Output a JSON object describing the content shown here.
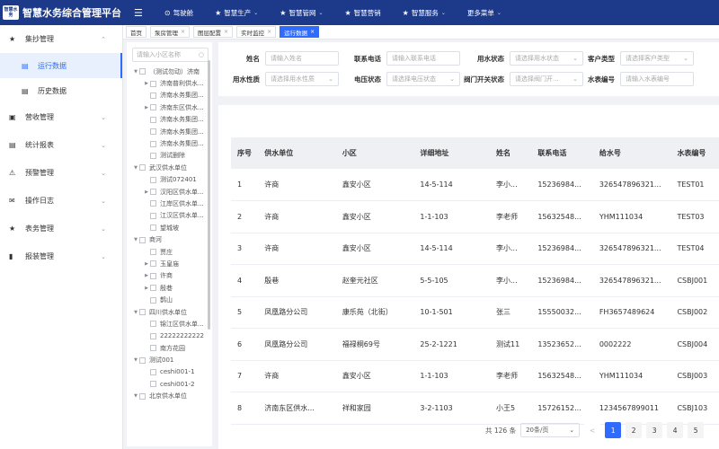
{
  "app": {
    "logo_text": "智慧水务",
    "title": "智慧水务综合管理平台"
  },
  "topnav": [
    {
      "icon": "⊙",
      "label": "驾驶舱",
      "dropdown": false
    },
    {
      "icon": "★",
      "label": "智慧生产",
      "dropdown": true
    },
    {
      "icon": "★",
      "label": "智慧管网",
      "dropdown": true
    },
    {
      "icon": "★",
      "label": "智慧营销",
      "dropdown": false
    },
    {
      "icon": "★",
      "label": "智慧服务",
      "dropdown": true
    },
    {
      "icon": "",
      "label": "更多菜单",
      "dropdown": true
    }
  ],
  "sidebar": {
    "items": [
      {
        "icon": "★",
        "label": "集抄管理",
        "expanded": true
      },
      {
        "icon": "▣",
        "label": "营收管理"
      },
      {
        "icon": "▤",
        "label": "统计报表"
      },
      {
        "icon": "⚠",
        "label": "预警管理"
      },
      {
        "icon": "✉",
        "label": "操作日志"
      },
      {
        "icon": "★",
        "label": "表务管理"
      },
      {
        "icon": "▮",
        "label": "报装管理"
      }
    ],
    "subitems": [
      {
        "label": "运行数据",
        "active": true
      },
      {
        "label": "历史数据",
        "active": false
      }
    ]
  },
  "tabs": [
    {
      "label": "首页",
      "closable": false,
      "active": false
    },
    {
      "label": "泵房管理",
      "closable": true,
      "active": false
    },
    {
      "label": "图层配置",
      "closable": true,
      "active": false
    },
    {
      "label": "实时监控",
      "closable": true,
      "active": false
    },
    {
      "label": "运行数据",
      "closable": true,
      "active": true
    }
  ],
  "tree": {
    "search_placeholder": "请输入小区名称",
    "nodes": [
      {
        "level": 0,
        "toggle": "▼",
        "label": "（测试勿动）济南"
      },
      {
        "level": 1,
        "toggle": "▶",
        "label": "济南普利供水..."
      },
      {
        "level": 1,
        "toggle": "",
        "label": "济南水务集团..."
      },
      {
        "level": 1,
        "toggle": "▶",
        "label": "济南东区供水..."
      },
      {
        "level": 1,
        "toggle": "",
        "label": "济南水务集团..."
      },
      {
        "level": 1,
        "toggle": "",
        "label": "济南水务集团..."
      },
      {
        "level": 1,
        "toggle": "",
        "label": "济南水务集团..."
      },
      {
        "level": 1,
        "toggle": "",
        "label": "测试删除"
      },
      {
        "level": 0,
        "toggle": "▼",
        "label": "武汉供水单位"
      },
      {
        "level": 1,
        "toggle": "",
        "label": "测试072401"
      },
      {
        "level": 1,
        "toggle": "▶",
        "label": "汉阳区供水单..."
      },
      {
        "level": 1,
        "toggle": "",
        "label": "江岸区供水单..."
      },
      {
        "level": 1,
        "toggle": "",
        "label": "江汉区供水单..."
      },
      {
        "level": 1,
        "toggle": "",
        "label": "望城坡"
      },
      {
        "level": 0,
        "toggle": "▼",
        "label": "商河"
      },
      {
        "level": 1,
        "toggle": "",
        "label": "贾庄"
      },
      {
        "level": 1,
        "toggle": "▶",
        "label": "玉皇庙"
      },
      {
        "level": 1,
        "toggle": "▶",
        "label": "许商"
      },
      {
        "level": 1,
        "toggle": "▶",
        "label": "殷巷"
      },
      {
        "level": 1,
        "toggle": "",
        "label": "鹊山"
      },
      {
        "level": 0,
        "toggle": "▼",
        "label": "四川供水单位"
      },
      {
        "level": 1,
        "toggle": "",
        "label": "锦江区供水单..."
      },
      {
        "level": 1,
        "toggle": "",
        "label": "22222222222"
      },
      {
        "level": 1,
        "toggle": "",
        "label": "南方花园"
      },
      {
        "level": 0,
        "toggle": "▼",
        "label": "测试001"
      },
      {
        "level": 1,
        "toggle": "",
        "label": "ceshi001-1"
      },
      {
        "level": 1,
        "toggle": "",
        "label": "ceshi001-2"
      },
      {
        "level": 0,
        "toggle": "▼",
        "label": "北京供水单位"
      }
    ]
  },
  "filters": [
    {
      "label": "姓名",
      "placeholder": "请输入姓名",
      "select": false
    },
    {
      "label": "联系电话",
      "placeholder": "请输入联系电话",
      "select": false
    },
    {
      "label": "用水状态",
      "placeholder": "请选择用水状态",
      "select": true
    },
    {
      "label": "客户类型",
      "placeholder": "请选择客户类型",
      "select": true
    },
    {
      "label": "用水性质",
      "placeholder": "请选择用水性质",
      "select": true
    },
    {
      "label": "电压状态",
      "placeholder": "请选择电压状态",
      "select": true
    },
    {
      "label": "阀门开关状态",
      "placeholder": "请选择阀门开...",
      "select": true
    },
    {
      "label": "水表编号",
      "placeholder": "请输入水表编号",
      "select": false
    }
  ],
  "table": {
    "columns": [
      "序号",
      "供水单位",
      "小区",
      "详细地址",
      "姓名",
      "联系电话",
      "给水号",
      "水表编号"
    ],
    "rows": [
      [
        "1",
        "许商",
        "鑫安小区",
        "14-5-114",
        "李小...",
        "15236984...",
        "326547896321...",
        "TEST01"
      ],
      [
        "2",
        "许商",
        "鑫安小区",
        "1-1-103",
        "李老师",
        "15632548...",
        "YHM111034",
        "TEST03"
      ],
      [
        "3",
        "许商",
        "鑫安小区",
        "14-5-114",
        "李小...",
        "15236984...",
        "326547896321...",
        "TEST04"
      ],
      [
        "4",
        "殷巷",
        "赵奎元社区",
        "5-5-105",
        "李小...",
        "15236984...",
        "326547896321...",
        "CSBJ001"
      ],
      [
        "5",
        "凤凰路分公司",
        "康乐苑（北街）",
        "10-1-501",
        "张三",
        "15550032...",
        "FH3657489624",
        "CSBJ002"
      ],
      [
        "6",
        "凤凰路分公司",
        "福禄桐69号",
        "25-2-1221",
        "测试11",
        "13523652...",
        "0002222",
        "CSBJ004"
      ],
      [
        "7",
        "许商",
        "鑫安小区",
        "1-1-103",
        "李老师",
        "15632548...",
        "YHM111034",
        "CSBJ003"
      ],
      [
        "8",
        "济南东区供水...",
        "祥和家园",
        "3-2-1103",
        "小王5",
        "15726152...",
        "1234567899011",
        "CSBJ103"
      ]
    ]
  },
  "pager": {
    "total": "共 126 条",
    "page_size": "20条/页",
    "prev": "<",
    "pages": [
      "1",
      "2",
      "3",
      "4",
      "5"
    ],
    "current": "1"
  },
  "icons": {
    "dropdown": "⌄",
    "collapse": "⌃",
    "close": "×",
    "search": "○",
    "menu": "☰"
  },
  "colors": {
    "header_bg": "#1d3a8a",
    "accent": "#2f6bff"
  }
}
